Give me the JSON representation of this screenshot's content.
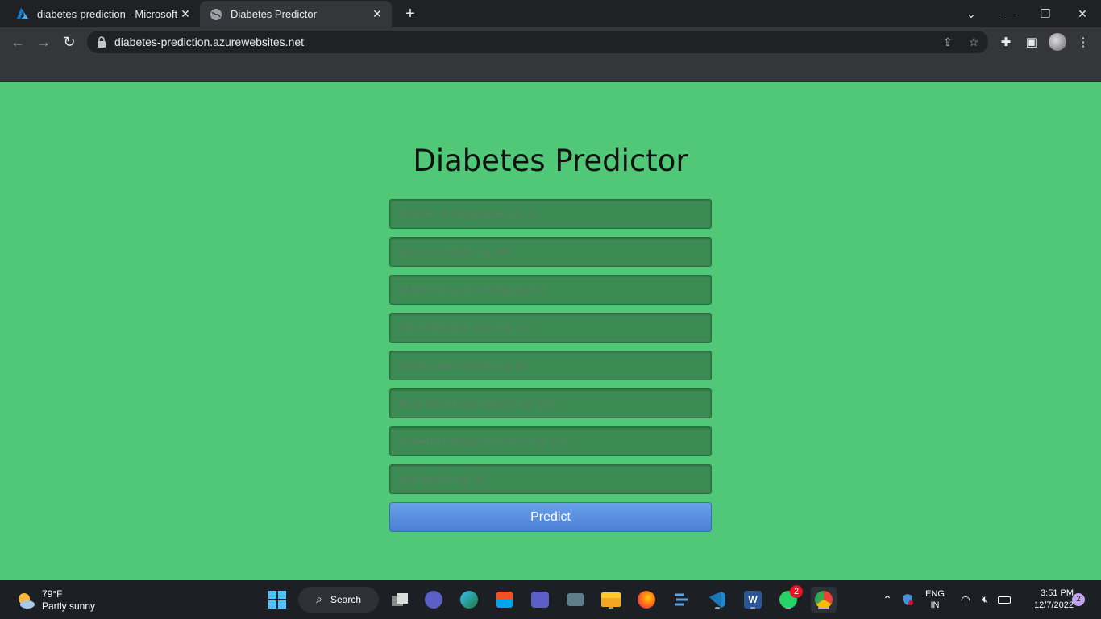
{
  "browser": {
    "tabs": [
      {
        "title": "diabetes-prediction - Microsoft A",
        "icon": "azure-icon",
        "active": false
      },
      {
        "title": "Diabetes Predictor",
        "icon": "globe-icon",
        "active": true
      }
    ],
    "url": "diabetes-prediction.azurewebsites.net"
  },
  "page": {
    "heading": "Diabetes Predictor",
    "fields": [
      {
        "placeholder": "Number of Pregnancies eg. 0"
      },
      {
        "placeholder": "Glucose (mg/dL) eg. 80"
      },
      {
        "placeholder": "Blood Pressure (mmHg) eg. 80"
      },
      {
        "placeholder": "Skin Thickness (mm) eg. 20"
      },
      {
        "placeholder": "Insulin Level (IU/mL) eg. 80"
      },
      {
        "placeholder": "Body Mass Index (kg/m²) eg. 23.1"
      },
      {
        "placeholder": "Diabetes Pedigree Function eg. 0.52"
      },
      {
        "placeholder": "Age (years) eg. 34"
      }
    ],
    "predict_label": "Predict",
    "colors": {
      "background": "#50c878",
      "input": "#3c8a54",
      "button": "#5a91e0"
    }
  },
  "taskbar": {
    "weather_temp": "79°F",
    "weather_desc": "Partly sunny",
    "search_label": "Search",
    "whatsapp_badge": "2",
    "language": "ENG",
    "region": "IN",
    "time": "3:51 PM",
    "date": "12/7/2022",
    "notification_count": "2"
  }
}
